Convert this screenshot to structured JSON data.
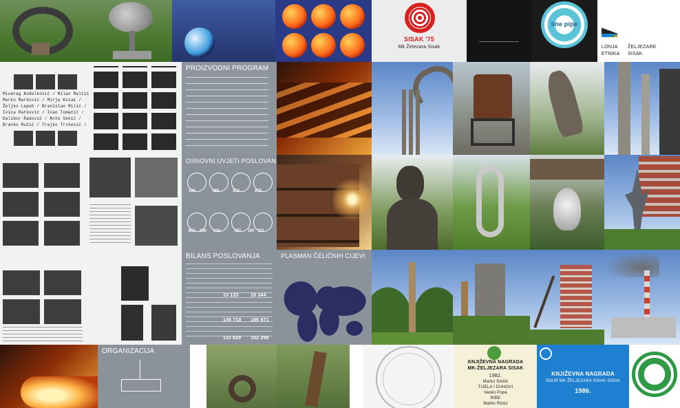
{
  "tiles": {
    "row1": {
      "spiral_cover_label": "SISAK '75",
      "spiral_cover_sub": "Mk Železara Sisak",
      "line_pipe_label": "line pipe",
      "catalog_lines": [
        "LONJA",
        "ETNIKA",
        "ŽELJEZARE",
        "SISAK"
      ]
    },
    "row2": {
      "names_text": [
        "Miodrag Anđelković / Milan Maltić /",
        "Marko Marković / Mirja Kozak /",
        "Željko Lapuh / Branislav Milić /",
        "Ivica Ratković / Ivan Tomačić /",
        "Dalibor Radović / Ante Sekić /",
        "Branko Ružić / Trajko Trošević /"
      ],
      "program_title": "PROIZVODNI PROGRAM"
    },
    "row3": {
      "conditions_title": "OSNOVNI UVJETI POSLOVANJA",
      "conditions_values": [
        "190",
        "189",
        "352",
        "253",
        "850",
        "260",
        "134",
        "157",
        "197",
        "121"
      ]
    },
    "row4": {
      "balance_title": "BILANS POSLOVANJA",
      "balance_values": [
        "10 133",
        "18 344",
        "146 718",
        "186 971",
        "110 929",
        "162 298"
      ],
      "placement_title": "PLASMAN ČELIČNIH CIJEVI"
    },
    "row5": {
      "org_title": "ORGANIZACIJA",
      "award1_title": "KNJIŽEVNA NAGRADA",
      "award1_org": "MK-ŽELJEZARA SISAK",
      "award1_year": "1982.",
      "award1_names": [
        "Marko Smilić",
        "TIJELA I DUHOVI",
        "Vasko Popa",
        "RIBE",
        "Marko Ristić"
      ],
      "award2_title": "KNJIŽEVNA NAGRADA",
      "award2_org": "SOUR MK ŽELJEZARA SISAK-SISAK",
      "award2_year": "1986."
    }
  }
}
